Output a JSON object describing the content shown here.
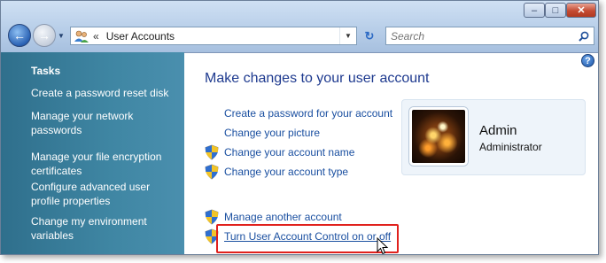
{
  "window": {
    "min_label": "–",
    "max_label": "□",
    "close_label": "✕"
  },
  "toolbar": {
    "back_icon": "back-arrow-icon",
    "forward_icon": "forward-arrow-icon",
    "address_separator": "«",
    "address_text": "User Accounts",
    "refresh_glyph": "↻",
    "search_placeholder": "Search"
  },
  "sidebar": {
    "title": "Tasks",
    "items": [
      {
        "label": "Create a password reset disk"
      },
      {
        "label": "Manage your network passwords"
      },
      {
        "label": "Manage your file encryption certificates"
      },
      {
        "label": "Configure advanced user profile properties"
      },
      {
        "label": "Change my environment variables"
      }
    ]
  },
  "main": {
    "heading": "Make changes to your user account",
    "help_label": "?",
    "links": [
      {
        "label": "Create a password for your account",
        "shield": false
      },
      {
        "label": "Change your picture",
        "shield": false
      },
      {
        "label": "Change your account name",
        "shield": true
      },
      {
        "label": "Change your account type",
        "shield": true
      },
      {
        "label": "Manage another account",
        "shield": true
      },
      {
        "label": "Turn User Account Control on or off",
        "shield": true
      }
    ],
    "account": {
      "name": "Admin",
      "role": "Administrator"
    }
  },
  "colors": {
    "sidebar_bg": "#3f86a3",
    "link": "#1a4fa0",
    "heading": "#1e3a8f",
    "highlight": "#e0211d"
  }
}
